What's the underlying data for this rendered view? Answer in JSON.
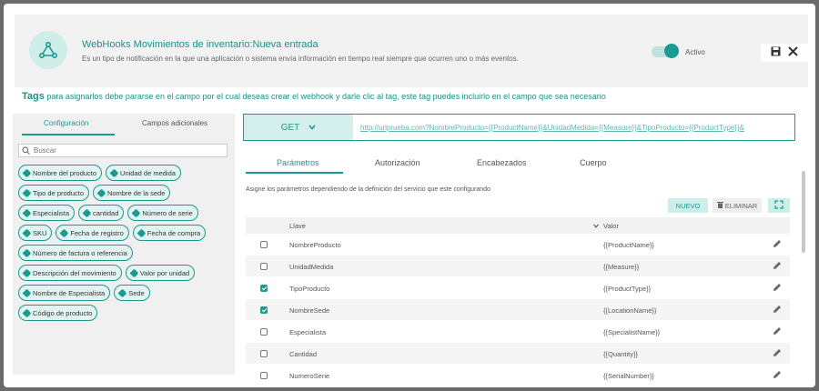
{
  "header": {
    "title": "WebHooks Movimientos de inventario:Nueva entrada",
    "subtitle": "Es un tipo de notificación en la que una aplicación o sistema envía información en tiempo real siempre que ocurren uno o más eventos.",
    "toggle_label": "Activo",
    "toggle_on": true
  },
  "note": {
    "bold": "Tags",
    "text": " para asignarlos debe pararse en el campo por el cual deseas crear el webhook y darle clic al tag, este tag puedes incluirlo en el campo que sea necesario"
  },
  "left_panel": {
    "tabs": [
      {
        "label": "Configuración"
      },
      {
        "label": "Campos adicionales"
      }
    ],
    "search_placeholder": "Buscar",
    "tags": [
      "Nombre del producto",
      "Unidad de medida",
      "Tipo de producto",
      "Nombre de la sede",
      "Especialista",
      "cantidad",
      "Número de serie",
      "SKU",
      "Fecha de registro",
      "Fecha de compra",
      "Número de factura o referencia",
      "Descripción del movimiento",
      "Valor por unidad",
      "Nombre de Especialista",
      "Sede",
      "Código de producto"
    ]
  },
  "request": {
    "method": "GET",
    "url": "http://urlprueba.com?NombreProducto={{ProductName}}&UnidadMedida={{Measure}}&TipoProducto={{ProductType}}&"
  },
  "tabs": [
    {
      "label": "Parámetros"
    },
    {
      "label": "Autorización"
    },
    {
      "label": "Encabezados"
    },
    {
      "label": "Cuerpo"
    }
  ],
  "description": "Asigne los parámetros dependiendo de la definición del servicio que este configurando",
  "buttons": {
    "new": "NUEVO",
    "delete": "ELIMINAR"
  },
  "table": {
    "headers": {
      "key": "Llave",
      "value": "Valor"
    },
    "rows": [
      {
        "key": "NombreProducto",
        "value": "{{ProductName}}",
        "checked": false
      },
      {
        "key": "UnidadMedida",
        "value": "{{Measure}}",
        "checked": false
      },
      {
        "key": "TipoProducto",
        "value": "{{ProductType}}",
        "checked": true
      },
      {
        "key": "NombreSede",
        "value": "{{LocationName}}",
        "checked": true
      },
      {
        "key": "Especialista",
        "value": "{{SpecialistName}}",
        "checked": false
      },
      {
        "key": "Cantidad",
        "value": "{{Quantity}}",
        "checked": false
      },
      {
        "key": "NumeroSerie",
        "value": "{{SerialNumber}}",
        "checked": false
      }
    ]
  },
  "colors": {
    "accent": "#1a9a90",
    "accent_light": "#d5efec"
  }
}
